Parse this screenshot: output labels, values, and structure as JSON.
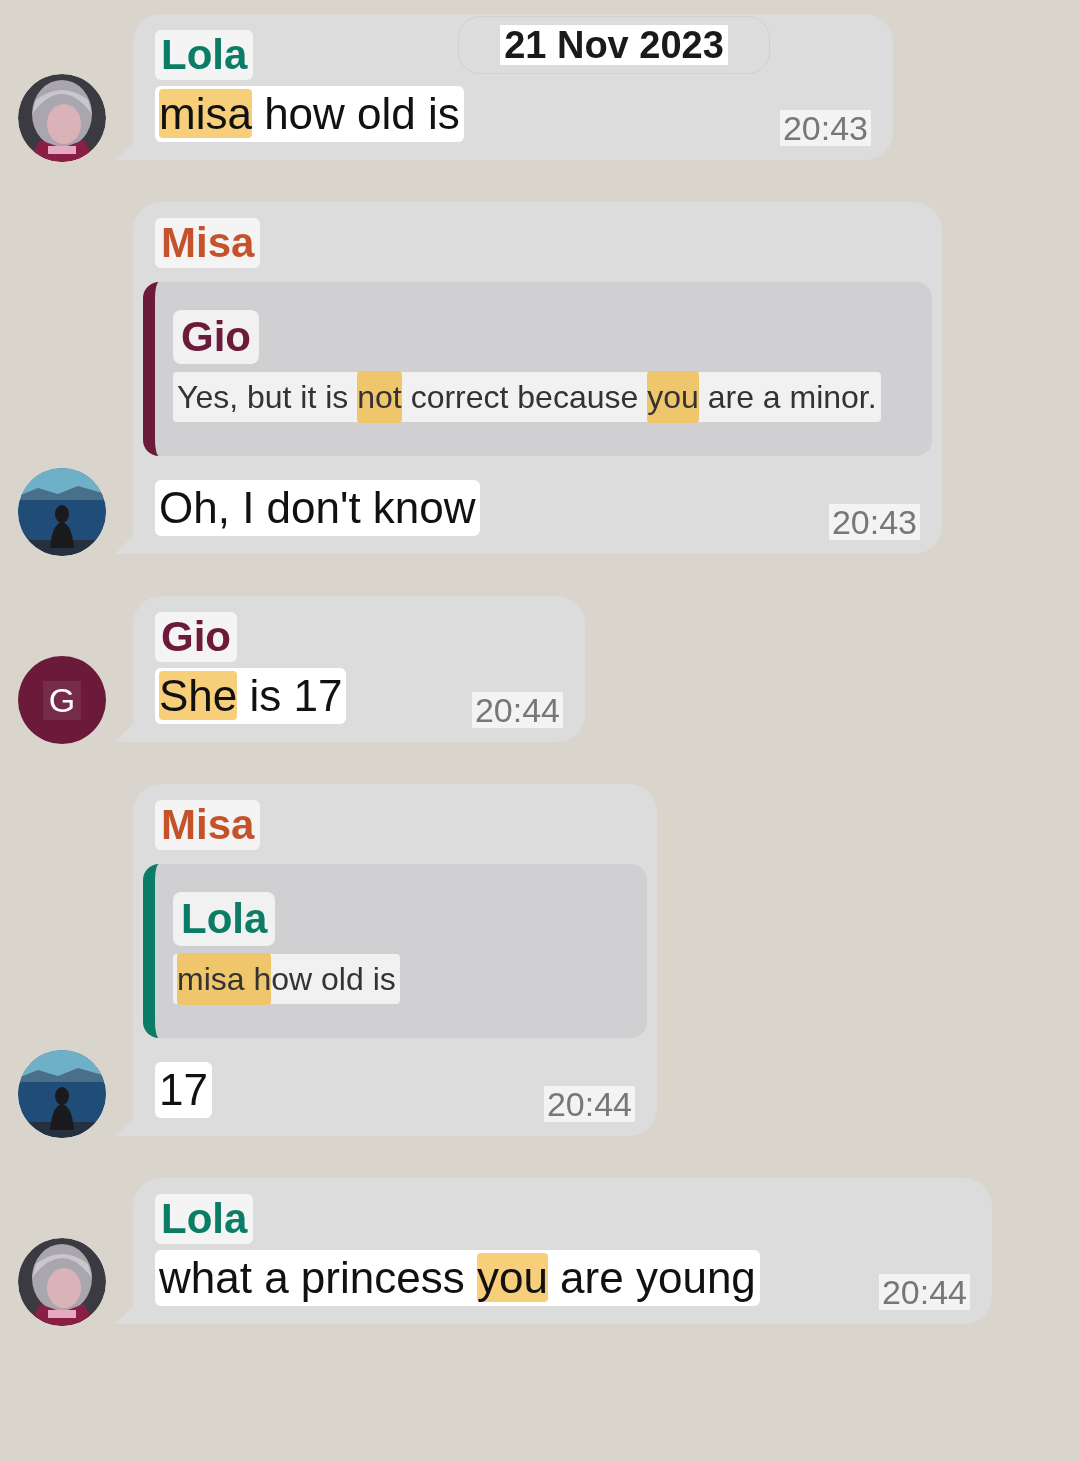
{
  "date": "21 Nov 2023",
  "messages": [
    {
      "sender": "Lola",
      "color": "#0b7c66",
      "avatar": {
        "kind": "picture"
      },
      "segments": [
        {
          "text": "misa",
          "highlighted": true
        },
        {
          "text": " how old is",
          "highlighted": false
        }
      ],
      "time": "20:43"
    },
    {
      "sender": "Misa",
      "color": "#c4532b",
      "avatar": {
        "kind": "picture"
      },
      "quote": {
        "sender": "Gio",
        "color": "#6b1a3a",
        "segments": [
          {
            "text": "Yes, but it is ",
            "highlighted": false
          },
          {
            "text": "not",
            "highlighted": true
          },
          {
            "text": " correct because ",
            "highlighted": false
          },
          {
            "text": "you",
            "highlighted": true
          },
          {
            "text": " are a minor.",
            "highlighted": false
          }
        ]
      },
      "segments": [
        {
          "text": "Oh, I don't know",
          "highlighted": false
        }
      ],
      "time": "20:43"
    },
    {
      "sender": "Gio",
      "color": "#6b1a3a",
      "avatar": {
        "kind": "letter",
        "letter": "G"
      },
      "segments": [
        {
          "text": "She",
          "highlighted": true
        },
        {
          "text": " is 17",
          "highlighted": false
        }
      ],
      "time": "20:44"
    },
    {
      "sender": "Misa",
      "color": "#c4532b",
      "avatar": {
        "kind": "picture"
      },
      "quote": {
        "sender": "Lola",
        "color": "#0b7c66",
        "segments": [
          {
            "text": "misa h",
            "highlighted": true
          },
          {
            "text": "ow old is",
            "highlighted": false
          }
        ]
      },
      "segments": [
        {
          "text": "17",
          "highlighted": false
        }
      ],
      "time": "20:44"
    },
    {
      "sender": "Lola",
      "color": "#0b7c66",
      "avatar": {
        "kind": "picture"
      },
      "segments": [
        {
          "text": "what a princess ",
          "highlighted": false
        },
        {
          "text": "you",
          "highlighted": true
        },
        {
          "text": " are young",
          "highlighted": false
        }
      ],
      "time": "20:44"
    }
  ]
}
